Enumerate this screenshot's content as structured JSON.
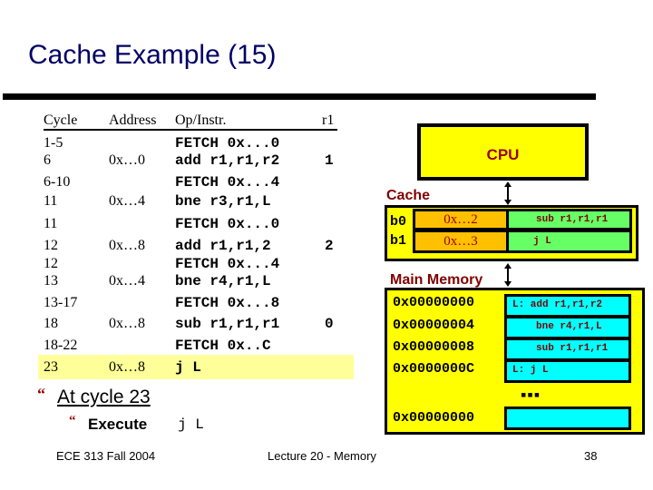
{
  "slide": {
    "title": "Cache Example (15)",
    "footer": {
      "left": "ECE 313 Fall 2004",
      "center": "Lecture 20 - Memory",
      "page_number": "38"
    }
  },
  "trace_table": {
    "headers": {
      "cycle": "Cycle",
      "address": "Address",
      "op": "Op/Instr.",
      "r1": "r1"
    },
    "rows": [
      {
        "cycle": "1-5",
        "address": "",
        "op": "FETCH 0x...0",
        "r1": ""
      },
      {
        "cycle": "6",
        "address": "0x…0",
        "op": "add r1,r1,r2",
        "r1": "1"
      },
      {
        "cycle": "6-10",
        "address": "",
        "op": "FETCH 0x...4",
        "r1": ""
      },
      {
        "cycle": "11",
        "address": "0x…4",
        "op": "bne r3,r1,L",
        "r1": ""
      },
      {
        "cycle": "11",
        "address": "",
        "op": "FETCH 0x...0",
        "r1": ""
      },
      {
        "cycle": "12",
        "address": "0x…8",
        "op": "add r1,r1,2",
        "r1": "2"
      },
      {
        "cycle": "12",
        "address": "",
        "op": "FETCH 0x...4",
        "r1": ""
      },
      {
        "cycle": "13",
        "address": "0x…4",
        "op": "bne r4,r1,L",
        "r1": ""
      },
      {
        "cycle": "13-17",
        "address": "",
        "op": "FETCH 0x...8",
        "r1": ""
      },
      {
        "cycle": "18",
        "address": "0x…8",
        "op": "sub r1,r1,r1",
        "r1": "0"
      },
      {
        "cycle": "18-22",
        "address": "",
        "op": "FETCH 0x..C",
        "r1": ""
      },
      {
        "cycle": "23",
        "address": "0x…8",
        "op": "j L",
        "r1": "",
        "highlighted": true
      }
    ]
  },
  "diagram": {
    "cpu_label": "CPU",
    "cache": {
      "label": "Cache",
      "blocks": [
        {
          "name": "b0",
          "tag": "0x…2",
          "data": "sub r1,r1,r1"
        },
        {
          "name": "b1",
          "tag": "0x…3",
          "data": "j L"
        }
      ]
    },
    "main_memory": {
      "label": "Main Memory",
      "rows": [
        {
          "address": "0x00000000",
          "content": "L: add r1,r1,r2"
        },
        {
          "address": "0x00000004",
          "content": "bne r4,r1,L"
        },
        {
          "address": "0x00000008",
          "content": "sub r1,r1,r1"
        },
        {
          "address": "0x0000000C",
          "content": "L: j L"
        }
      ],
      "ellipsis": "▪▪▪",
      "last_row": {
        "address": "0x00000000",
        "content": ""
      }
    },
    "colors": {
      "box_fill": "#FFFF00",
      "tag_fill": "#FFC000",
      "cache_data_fill": "#66FF66",
      "memory_cell_fill": "#00FFFF",
      "label_color": "#800000",
      "title_color": "#000066",
      "highlight_row": "#FFFF99"
    }
  },
  "bullets": {
    "glyph": "“",
    "level1": "At cycle 23",
    "level2_label": "Execute",
    "level2_code": "j L"
  }
}
